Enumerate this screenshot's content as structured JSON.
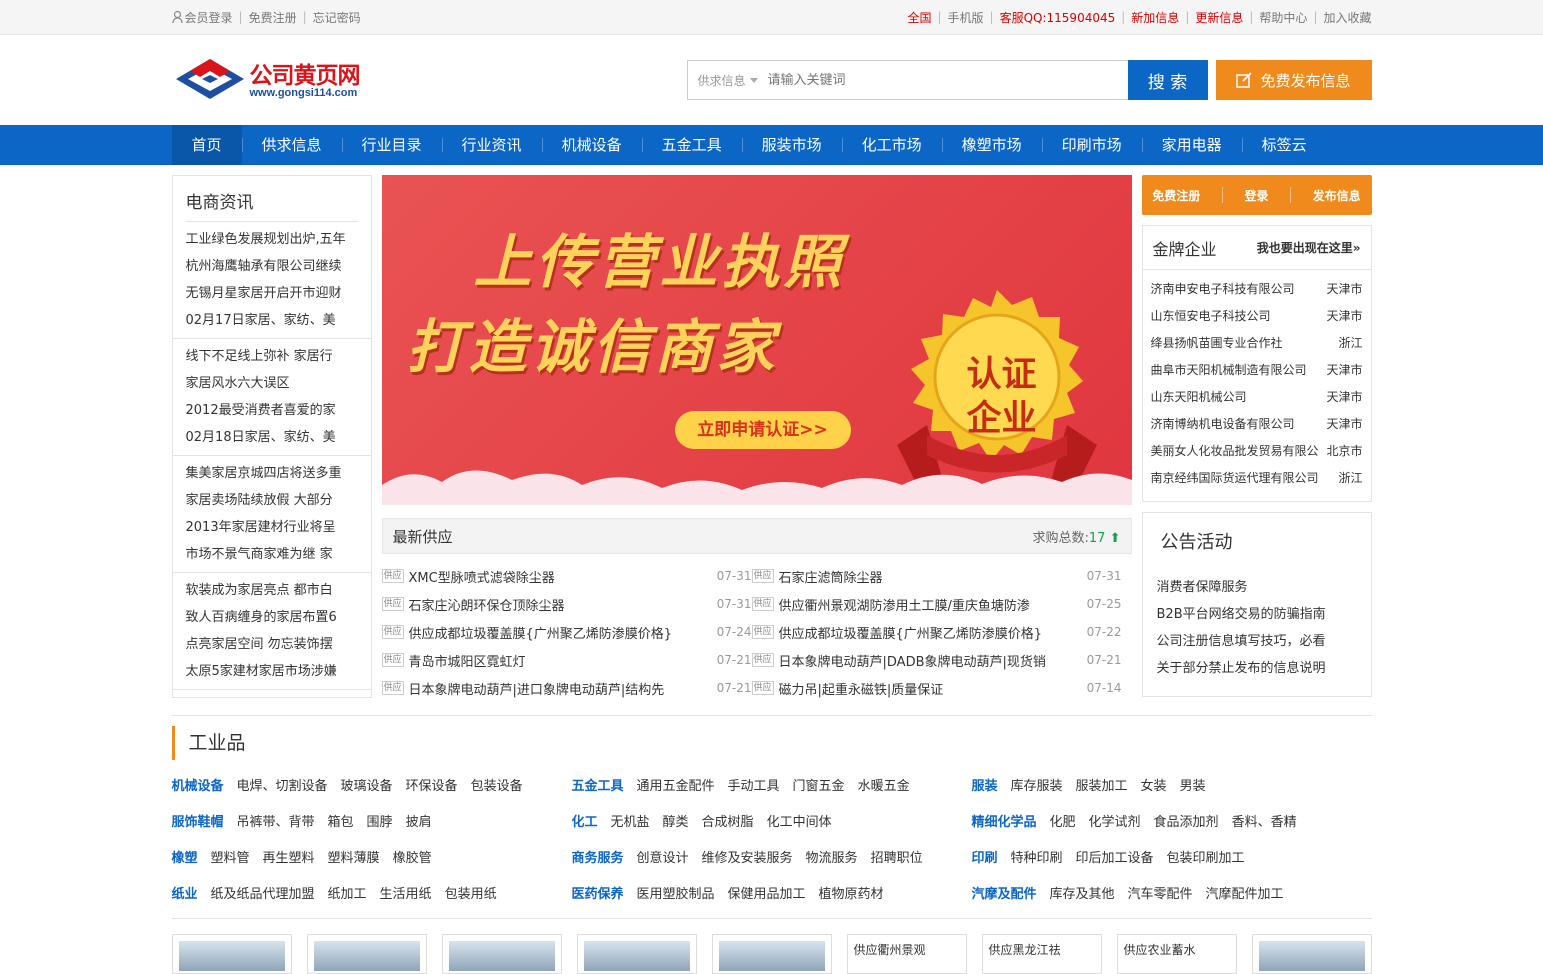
{
  "topbar": {
    "login": "会员登录",
    "register": "免费注册",
    "forgot": "忘记密码",
    "region": "全国",
    "mobile": "手机版",
    "qq": "客服QQ:115904045",
    "new_info": "新加信息",
    "updated_info": "更新信息",
    "help": "帮助中心",
    "favorite": "加入收藏"
  },
  "logo": {
    "title": "公司黄页网",
    "url": "www.gongsi114.com"
  },
  "search": {
    "category": "供求信息",
    "placeholder": "请输入关键词",
    "button": "搜 索",
    "publish": "免费发布信息"
  },
  "nav": [
    "首页",
    "供求信息",
    "行业目录",
    "行业资讯",
    "机械设备",
    "五金工具",
    "服装市场",
    "化工市场",
    "橡塑市场",
    "印刷市场",
    "家用电器",
    "标签云"
  ],
  "left": {
    "title": "电商资讯",
    "groups": [
      [
        "工业绿色发展规划出炉,五年",
        "杭州海鹰轴承有限公司继续",
        "无锡月星家居开启开市迎财",
        "02月17日家居、家纺、美"
      ],
      [
        "线下不足线上弥补 家居行",
        "家居风水六大误区",
        "2012最受消费者喜爱的家",
        "02月18日家居、家纺、美"
      ],
      [
        "集美家居京城四店将送多重",
        "家居卖场陆续放假 大部分",
        "2013年家居建材行业将呈",
        "市场不景气商家难为继 家"
      ],
      [
        "软装成为家居亮点 都市白",
        "致人百病缠身的家居布置6",
        "点亮家居空间 勿忘装饰摆",
        "太原5家建材家居市场涉嫌"
      ]
    ]
  },
  "banner": {
    "line1": "上传营业执照",
    "line2": "打造诚信商家",
    "button": "立即申请认证>>",
    "medal": "认证企业"
  },
  "supply": {
    "title": "最新供应",
    "count_label": "求购总数:",
    "count": "17",
    "tag": "供应",
    "items": [
      {
        "title": "XMC型脉喷式滤袋除尘器",
        "date": "07-31"
      },
      {
        "title": "石家庄滤筒除尘器",
        "date": "07-31"
      },
      {
        "title": "石家庄沁朗环保仓顶除尘器",
        "date": "07-31"
      },
      {
        "title": "供应衢州景观湖防渗用土工膜/重庆鱼塘防渗",
        "date": "07-25"
      },
      {
        "title": "供应成都垃圾覆盖膜{广州聚乙烯防渗膜价格}",
        "date": "07-24"
      },
      {
        "title": "供应成都垃圾覆盖膜{广州聚乙烯防渗膜价格}",
        "date": "07-22"
      },
      {
        "title": "青岛市城阳区霓虹灯",
        "date": "07-21"
      },
      {
        "title": "日本象牌电动葫芦|DADB象牌电动葫芦|现货销",
        "date": "07-21"
      },
      {
        "title": "日本象牌电动葫芦|进口象牌电动葫芦|结构先",
        "date": "07-21"
      },
      {
        "title": "磁力吊|起重永磁铁|质量保证",
        "date": "07-14"
      }
    ]
  },
  "right": {
    "reg": "免费注册",
    "login": "登录",
    "publish": "发布信息",
    "gold_title": "金牌企业",
    "gold_more": "我也要出现在这里»",
    "companies": [
      {
        "name": "济南申安电子科技有限公司",
        "city": "天津市"
      },
      {
        "name": "山东恒安电子科技公司",
        "city": "天津市"
      },
      {
        "name": "绛县扬帆苗圃专业合作社",
        "city": "浙江"
      },
      {
        "name": "曲阜市天阳机械制造有限公司",
        "city": "天津市"
      },
      {
        "name": "山东天阳机械公司",
        "city": "天津市"
      },
      {
        "name": "济南博纳机电设备有限公司",
        "city": "天津市"
      },
      {
        "name": "美丽女人化妆品批发贸易有限公",
        "city": "北京市"
      },
      {
        "name": "南京经纬国际货运代理有限公司",
        "city": "浙江"
      }
    ],
    "notice_title": "公告活动",
    "notices": [
      "消费者保障服务",
      "B2B平台网络交易的防骗指南",
      "公司注册信息填写技巧，必看",
      "关于部分禁止发布的信息说明"
    ]
  },
  "industry": {
    "title": "工业品",
    "rows": [
      {
        "main": "机械设备",
        "subs": [
          "电焊、切割设备",
          "玻璃设备",
          "环保设备",
          "包装设备"
        ]
      },
      {
        "main": "五金工具",
        "subs": [
          "通用五金配件",
          "手动工具",
          "门窗五金",
          "水暖五金"
        ]
      },
      {
        "main": "服装",
        "subs": [
          "库存服装",
          "服装加工",
          "女装",
          "男装"
        ]
      },
      {
        "main": "服饰鞋帽",
        "subs": [
          "吊裤带、背带",
          "箱包",
          "围脖",
          "披肩"
        ]
      },
      {
        "main": "化工",
        "subs": [
          "无机盐",
          "醇类",
          "合成树脂",
          "化工中间体"
        ]
      },
      {
        "main": "精细化学品",
        "subs": [
          "化肥",
          "化学试剂",
          "食品添加剂",
          "香料、香精"
        ]
      },
      {
        "main": "橡塑",
        "subs": [
          "塑料管",
          "再生塑料",
          "塑料薄膜",
          "橡胶管"
        ]
      },
      {
        "main": "商务服务",
        "subs": [
          "创意设计",
          "维修及安装服务",
          "物流服务",
          "招聘职位"
        ]
      },
      {
        "main": "印刷",
        "subs": [
          "特种印刷",
          "印后加工设备",
          "包装印刷加工"
        ]
      },
      {
        "main": "纸业",
        "subs": [
          "纸及纸品代理加盟",
          "纸加工",
          "生活用纸",
          "包装用纸"
        ]
      },
      {
        "main": "医药保养",
        "subs": [
          "医用塑胶制品",
          "保健用品加工",
          "植物原药材"
        ]
      },
      {
        "main": "汽摩及配件",
        "subs": [
          "库存及其他",
          "汽车零配件",
          "汽摩配件加工"
        ]
      }
    ]
  },
  "thumbs": [
    "",
    "",
    "",
    "",
    "",
    "供应衢州景观",
    "供应黑龙江祛",
    "供应农业蓄水",
    ""
  ]
}
